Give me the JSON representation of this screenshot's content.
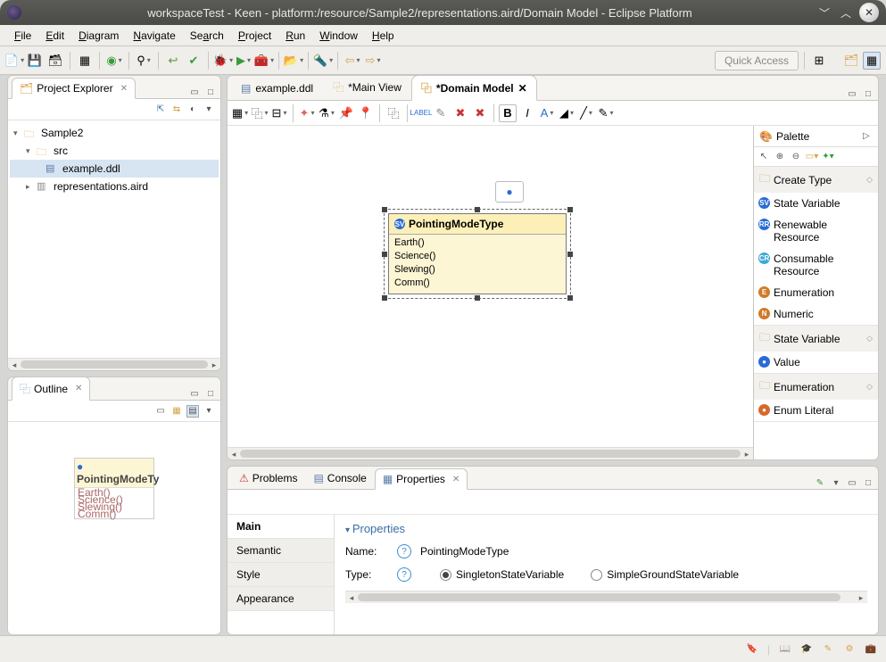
{
  "window": {
    "title": "workspaceTest - Keen - platform:/resource/Sample2/representations.aird/Domain Model - Eclipse Platform"
  },
  "menu": [
    "File",
    "Edit",
    "Diagram",
    "Navigate",
    "Search",
    "Project",
    "Run",
    "Window",
    "Help"
  ],
  "quickAccess": "Quick Access",
  "projectExplorer": {
    "title": "Project Explorer",
    "tree": {
      "root": "Sample2",
      "src": "src",
      "file1": "example.ddl",
      "file2": "representations.aird"
    }
  },
  "outline": {
    "title": "Outline",
    "miniHeader": "PointingModeTy",
    "miniRows": [
      "Earth()",
      "Science()",
      "Slewing()",
      "Comm()"
    ]
  },
  "editors": [
    {
      "label": "example.ddl",
      "active": false
    },
    {
      "label": "*Main View",
      "active": false
    },
    {
      "label": "*Domain Model",
      "active": true
    }
  ],
  "diagram": {
    "node": {
      "name": "PointingModeType",
      "attrs": [
        "Earth()",
        "Science()",
        "Slewing()",
        "Comm()"
      ]
    }
  },
  "palette": {
    "title": "Palette",
    "groups": [
      {
        "title": "Create Type",
        "items": [
          {
            "label": "State Variable",
            "color": "#2a6cd6",
            "g": "SV"
          },
          {
            "label": "Renewable Resource",
            "color": "#2a6cd6",
            "g": "RR"
          },
          {
            "label": "Consumable Resource",
            "color": "#3fa8d8",
            "g": "CR"
          },
          {
            "label": "Enumeration",
            "color": "#d07a2a",
            "g": "E"
          },
          {
            "label": "Numeric",
            "color": "#d07a2a",
            "g": "N"
          }
        ]
      },
      {
        "title": "State Variable",
        "items": [
          {
            "label": "Value",
            "color": "#2a6cd6",
            "g": "●"
          }
        ]
      },
      {
        "title": "Enumeration",
        "items": [
          {
            "label": "Enum Literal",
            "color": "#d66a2a",
            "g": "●"
          }
        ]
      }
    ]
  },
  "bottomTabs": [
    "Problems",
    "Console",
    "Properties"
  ],
  "properties": {
    "heading": "Properties",
    "sideTabs": [
      "Main",
      "Semantic",
      "Style",
      "Appearance"
    ],
    "nameLabel": "Name:",
    "nameValue": "PointingModeType",
    "typeLabel": "Type:",
    "typeOptions": [
      {
        "label": "SingletonStateVariable",
        "checked": true
      },
      {
        "label": "SimpleGroundStateVariable",
        "checked": false
      }
    ]
  }
}
